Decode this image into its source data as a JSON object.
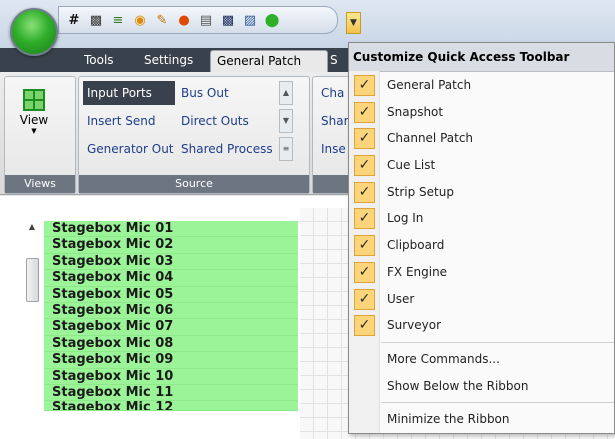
{
  "tabs": [
    "Tools",
    "Settings",
    "General Patch",
    "S"
  ],
  "ribbon": {
    "view_label": "View",
    "views_group": "Views",
    "source_group": "Source",
    "source_buttons": [
      [
        "Input Ports",
        "Bus Out"
      ],
      [
        "Insert Send",
        "Direct Outs"
      ],
      [
        "Generator Out",
        "Shared Process"
      ]
    ],
    "next_group_partial": [
      "Cha",
      "Shar",
      "Inse"
    ]
  },
  "list": {
    "rows": [
      "Stagebox Mic 01",
      "Stagebox Mic 02",
      "Stagebox Mic 03",
      "Stagebox Mic 04",
      "Stagebox Mic 05",
      "Stagebox Mic 06",
      "Stagebox Mic 07",
      "Stagebox Mic 08",
      "Stagebox Mic 09",
      "Stagebox Mic 10",
      "Stagebox Mic 11",
      "Stagebox Mic 12"
    ]
  },
  "menu": {
    "title": "Customize Quick Access Toolbar",
    "checked_items": [
      "General Patch",
      "Snapshot",
      "Channel Patch",
      "Cue List",
      "Strip Setup",
      "Log In",
      "Clipboard",
      "FX Engine",
      "User",
      "Surveyor"
    ],
    "more_commands": "More Commands...",
    "show_below": "Show Below the Ribbon",
    "minimize": "Minimize the Ribbon"
  },
  "qat_icons": [
    "grid-icon",
    "camera-icon",
    "patch-icon",
    "cue-icon",
    "strip-icon",
    "login-icon",
    "clipboard-icon",
    "fx-icon",
    "user-icon",
    "surveyor-icon"
  ],
  "colors": {
    "list_green": "#9bf497",
    "ribbon_dark": "#39424c",
    "check_bg": "#fcd47a"
  }
}
